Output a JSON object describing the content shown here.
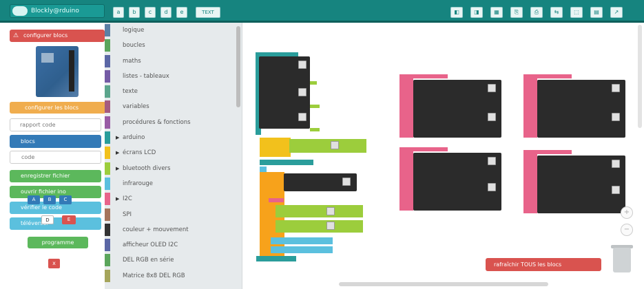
{
  "topbar": {
    "app_title": "Blockly@rduino",
    "buttons": [
      "a",
      "b",
      "c",
      "d",
      "e"
    ],
    "text_button": "TEXT",
    "right_buttons": [
      "◧",
      "◨",
      "▦",
      "⎘",
      "⎙",
      "⇆",
      "⬚",
      "▤",
      "↗"
    ]
  },
  "left": {
    "config_button": "configurer  blocs",
    "config_all": "configurer  les  blocs",
    "search_placeholder": "rapport code",
    "blocks_button": "blocs",
    "code_button": "code",
    "green1": "enregistrer  fichier",
    "green2": "ouvrir  fichier  ino",
    "lblue1": "vérifier  le  code",
    "lblue2": "téléverser",
    "mini_a": [
      "A",
      "B",
      "C"
    ],
    "mini_b": [
      "D",
      "E"
    ],
    "programme": "programme",
    "red_small": "x"
  },
  "toolbox": {
    "categories": [
      {
        "label": "logique",
        "color": "#5b80a5",
        "arrow": false
      },
      {
        "label": "boucles",
        "color": "#5ba55b",
        "arrow": false
      },
      {
        "label": "maths",
        "color": "#5b67a5",
        "arrow": false
      },
      {
        "label": "listes - tableaux",
        "color": "#745ba5",
        "arrow": false
      },
      {
        "label": "texte",
        "color": "#5ba58c",
        "arrow": false
      },
      {
        "label": "variables",
        "color": "#a55b80",
        "arrow": false
      },
      {
        "label": "procédures & fonctions",
        "color": "#995ba5",
        "arrow": false
      },
      {
        "label": "arduino",
        "color": "#2a9d9b",
        "arrow": true
      },
      {
        "label": "écrans LCD",
        "color": "#f2c11c",
        "arrow": true
      },
      {
        "label": "bluetooth divers",
        "color": "#9ccd3c",
        "arrow": true
      },
      {
        "label": "infrarouge",
        "color": "#5bc0de",
        "arrow": false
      },
      {
        "label": "I2C",
        "color": "#e8638a",
        "arrow": true
      },
      {
        "label": "SPI",
        "color": "#a5745b",
        "arrow": false
      },
      {
        "label": "couleur + mouvement",
        "color": "#333333",
        "arrow": false
      },
      {
        "label": "afficheur OLED I2C",
        "color": "#5b67a5",
        "arrow": false
      },
      {
        "label": "DEL RGB en série",
        "color": "#5ba55b",
        "arrow": false
      },
      {
        "label": "Matrice 8x8 DEL RGB",
        "color": "#a5a55b",
        "arrow": false
      }
    ]
  },
  "workspace": {
    "refresh_button": "rafraîchir  TOUS  les  blocs"
  }
}
